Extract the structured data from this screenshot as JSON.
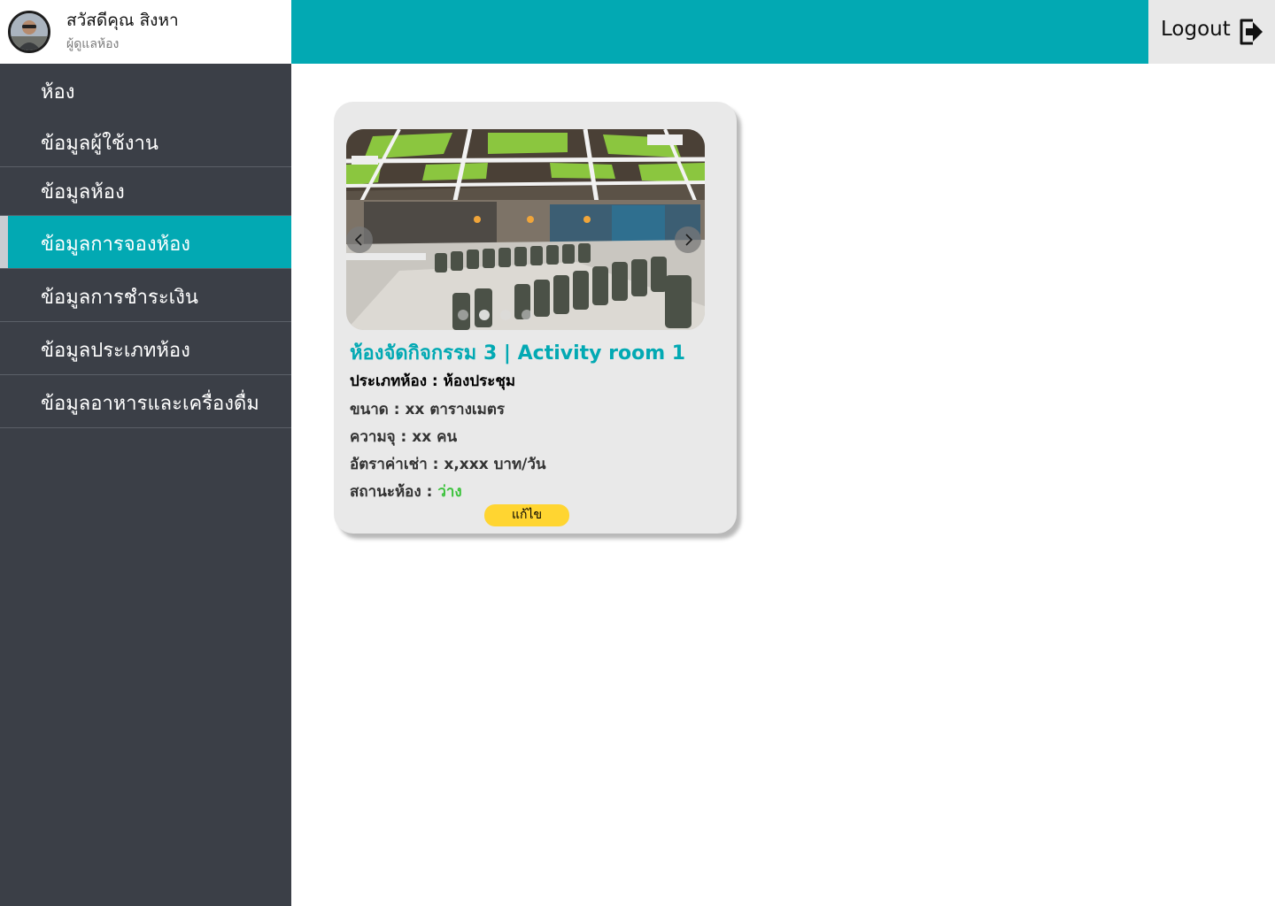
{
  "colors": {
    "accent": "#02a9b3",
    "sidebar_bg": "#3b3f47",
    "status_available": "#3cc23c",
    "edit_button": "#ffd531"
  },
  "user": {
    "name": "สวัสดีคุณ สิงหา",
    "role": "ผู้ดูแลห้อง"
  },
  "header": {
    "logout_label": "Logout"
  },
  "sidebar": {
    "items": [
      {
        "label": "ห้อง"
      },
      {
        "label": "ข้อมูลผู้ใช้งาน"
      },
      {
        "label": "ข้อมูลห้อง"
      },
      {
        "label": "ข้อมูลการจองห้อง",
        "active": true
      },
      {
        "label": "ข้อมูลการชำระเงิน"
      },
      {
        "label": "ข้อมูลประเภทห้อง"
      },
      {
        "label": "ข้อมูลอาหารและเครื่องดื่ม"
      }
    ]
  },
  "room_card": {
    "title": "ห้องจัดกิจกรรม 3 | Activity room 1",
    "type_line": "ประเภทห้อง : ห้องประชุม",
    "size_line": "ขนาด  :   xx ตารางเมตร",
    "capacity_line": "ความจุ :  xx คน",
    "rate_line": "อัตราค่าเช่า : x,xxx บาท/วัน",
    "status_label": "สถานะห้อง : ",
    "status_value": "ว่าง",
    "edit_label": "แก้ไข",
    "carousel": {
      "slide_count": 4,
      "active_slide": 1
    }
  }
}
